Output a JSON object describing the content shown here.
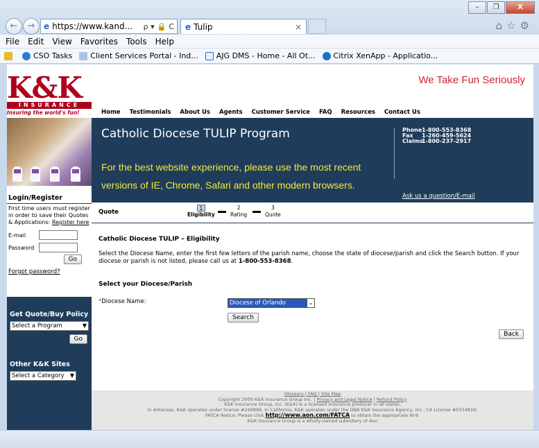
{
  "browser": {
    "address": "https://www.kand...",
    "address_controls": "ρ ▾ 🔒 C",
    "tab_title": "Tulip",
    "tab_close": "×",
    "menu": [
      "File",
      "Edit",
      "View",
      "Favorites",
      "Tools",
      "Help"
    ],
    "favorites": [
      "CSO Tasks",
      "Client Services Portal - Ind...",
      "AJG DMS - Home - All Ot...",
      "Citrix XenApp - Applicatio..."
    ],
    "window_buttons": [
      "–",
      "❐",
      "X"
    ]
  },
  "site": {
    "logo_main": "K&K",
    "logo_band": "INSURANCE",
    "logo_sub": "Insuring the world's fun!",
    "tagline": "We Take Fun Seriously",
    "nav": [
      "Home",
      "Testimonials",
      "About Us",
      "Agents",
      "Customer Service",
      "FAQ",
      "Resources",
      "Contact Us"
    ]
  },
  "banner": {
    "title": "Catholic Diocese TULIP Program",
    "notice": "For the best website experience, please use the most recent versions of IE, Chrome, Safari and other modern browsers.",
    "contacts": [
      {
        "label": "Phone",
        "value": "1-800-553-8368"
      },
      {
        "label": "Fax",
        "value": "1-260-459-5624"
      },
      {
        "label": "Claims",
        "value": "1-800-237-2917"
      }
    ],
    "ask_link": "Ask us a question/E-mail"
  },
  "steps": {
    "label": "Quote",
    "items": [
      {
        "num": "1",
        "name": "Eligibility"
      },
      {
        "num": "2",
        "name": "Rating"
      },
      {
        "num": "3",
        "name": "Quote"
      }
    ]
  },
  "sidebar": {
    "login_heading": "Login/Register",
    "login_text": "First time users must register in order to save their Quotes & Applications:",
    "register_link": "Register here",
    "email_label": "E-mail",
    "password_label": "Password",
    "go_label": "Go",
    "forgot_link": "Forgot password?",
    "quote_heading": "Get Quote/Buy Policy",
    "program_select": "Select a Program",
    "other_heading": "Other K&K Sites",
    "category_select": "Select a Category"
  },
  "main": {
    "title": "Catholic Diocese TULIP – Eligibility",
    "description": "Select the Diocese Name, enter the first few letters of the parish name, choose the state of diocese/parish and click the Search button. If your diocese or parish is not listed, please call us at ",
    "phone": "1-800-553-8368",
    "description_end": ".",
    "subheading": "Select your Diocese/Parish",
    "diocese_label": "Diocese Name:",
    "diocese_selected": "Diocese of Orlando",
    "search_label": "Search",
    "back_label": "Back"
  },
  "footer": {
    "links": "Glossary | FAQ | Site Map",
    "copyright": "Copyright 2009 K&K Insurance Group Inc. |",
    "privacy": "Privacy and Legal Notice",
    "sep": "|",
    "refund": "Refund Policy",
    "line2": "K&K Insurance Group, Inc. (K&K) is a licensed insurance producer in all states.",
    "line3": "In Arkansas, K&K operates under license #240898. In California, K&K operates under the DBA K&K Insurance Agency, Inc., CA License #0334819.",
    "fatca_pre": "FATCA Notice: Please click",
    "fatca_link": "http://www.aon.com/FATCA",
    "fatca_post": "to obtain the appropriate W-9.",
    "line5": "K&K Insurance Group is a wholly-owned subsidiary of Aon"
  }
}
